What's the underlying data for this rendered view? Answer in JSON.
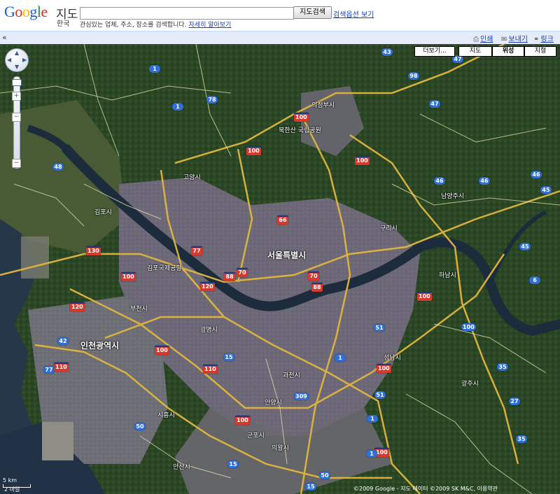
{
  "header": {
    "logo_letters": [
      "G",
      "o",
      "o",
      "g",
      "l",
      "e"
    ],
    "service_name": "지도",
    "region": "한국",
    "search_value": "",
    "search_button": "지도검색",
    "search_options": "검색옵션 보기",
    "hint_text": "관심있는 업체, 주소, 장소를 검색합니다.",
    "hint_link": "자세히 알아보기"
  },
  "toolbar": {
    "collapse": "«",
    "print": "인쇄",
    "send": "보내기",
    "link": "링크"
  },
  "map": {
    "map_types": {
      "more": "더보기...",
      "map": "지도",
      "satellite": "위성",
      "terrain": "지형"
    },
    "active_type": "satellite",
    "scale_label_km": "5 km",
    "scale_label_mi": "2 마일",
    "copyright": "©2009 Google - 지도 데이터 ©2009 SK M&C, 이용약관",
    "colors": {
      "forest": "#2d4a26",
      "urban": "#6e6a78",
      "river": "#1d2e3f",
      "sea": "#25364a",
      "road_major": "#e0b640",
      "road_minor": "#e8e4b0",
      "shield_expressway": "#d63a2f",
      "shield_national": "#2f6fd6"
    },
    "places": {
      "seoul": "서울특별시",
      "incheon": "인천광역시",
      "uijeongbu": "의정부시",
      "goyang": "고양시",
      "gimpo": "김포시",
      "guri": "구리시",
      "namyangju": "남양주시",
      "hanam": "하남시",
      "gwangmyeong": "광명시",
      "bucheon": "부천시",
      "siheung": "시흥시",
      "anyang": "안양시",
      "gunpo": "군포시",
      "uiwang": "의왕시",
      "gwacheon": "과천시",
      "seongnam": "성남시",
      "gwangju": "광주시",
      "ansan": "안산시",
      "gimpo_airport": "김포국제공항",
      "bukhansan": "북한산 국립공원"
    },
    "shields": [
      "43",
      "1",
      "47",
      "98",
      "100",
      "47",
      "1",
      "78",
      "100",
      "100",
      "48",
      "46",
      "46",
      "46",
      "45",
      "66",
      "130",
      "100",
      "77",
      "70",
      "88",
      "70",
      "100",
      "120",
      "88",
      "120",
      "45",
      "6",
      "100",
      "42",
      "77",
      "110",
      "100",
      "110",
      "15",
      "1",
      "51",
      "100",
      "35",
      "27",
      "100",
      "309",
      "1",
      "15",
      "50",
      "100",
      "15",
      "50",
      "35",
      "51",
      "1"
    ]
  }
}
